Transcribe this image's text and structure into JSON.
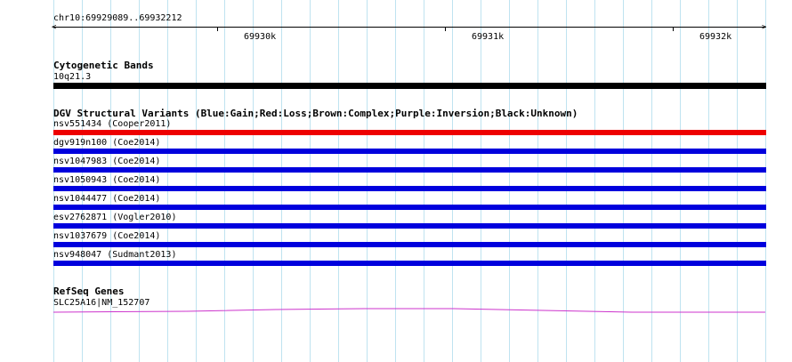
{
  "ruler": {
    "range_label": "chr10:69929089..69932212",
    "ticks": [
      "69930k",
      "69931k",
      "69932k"
    ]
  },
  "cytobands": {
    "title": "Cytogenetic Bands",
    "band": "10q21.3",
    "color": "#000000"
  },
  "dgv": {
    "title": "DGV Structural Variants (Blue:Gain;Red:Loss;Brown:Complex;Purple:Inversion;Black:Unknown)",
    "colors": {
      "gain": "#0000dd",
      "loss": "#ee0000"
    },
    "variants": [
      {
        "label": "nsv551434 (Cooper2011)",
        "type": "loss"
      },
      {
        "label": "dgv919n100 (Coe2014)",
        "type": "gain"
      },
      {
        "label": "nsv1047983 (Coe2014)",
        "type": "gain"
      },
      {
        "label": "nsv1050943 (Coe2014)",
        "type": "gain"
      },
      {
        "label": "nsv1044477 (Coe2014)",
        "type": "gain"
      },
      {
        "label": "esv2762871 (Vogler2010)",
        "type": "gain"
      },
      {
        "label": "nsv1037679 (Coe2014)",
        "type": "gain"
      },
      {
        "label": "nsv948047 (Sudmant2013)",
        "type": "gain"
      }
    ]
  },
  "refseq": {
    "title": "RefSeq Genes",
    "gene_label": "SLC25A16|NM_152707",
    "color": "#cc33cc"
  }
}
